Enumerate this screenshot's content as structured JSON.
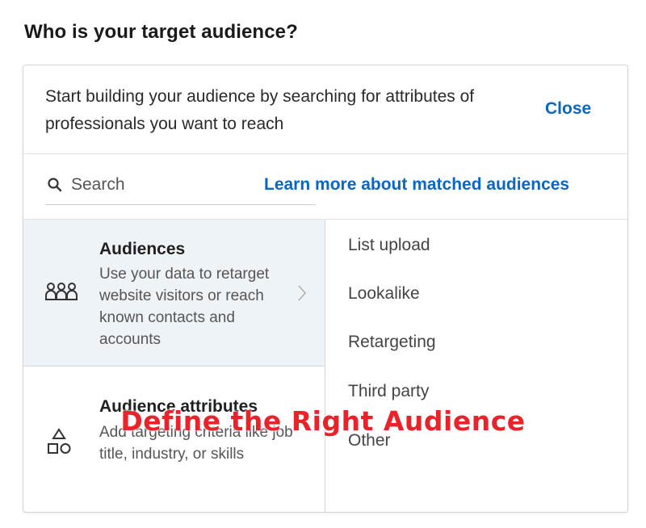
{
  "heading": "Who is your target audience?",
  "intro": {
    "text": "Start building your audience by searching for attributes of professionals you want to reach",
    "close_label": "Close"
  },
  "search": {
    "placeholder": "Search",
    "learn_more_label": "Learn more about matched audiences"
  },
  "categories": [
    {
      "title": "Audiences",
      "description": "Use your data to retarget website visitors or reach known contacts and accounts",
      "icon": "people-group-icon",
      "selected": true
    },
    {
      "title": "Audience attributes",
      "description": "Add targeting criteria like job title, industry, or skills",
      "icon": "shapes-icon",
      "selected": false
    }
  ],
  "options": [
    "List upload",
    "Lookalike",
    "Retargeting",
    "Third party",
    "Other"
  ],
  "overlay_caption": "Define the Right Audience",
  "colors": {
    "link": "#0a66c2",
    "selected_bg": "#eef3f8",
    "caption": "#e8232a"
  }
}
